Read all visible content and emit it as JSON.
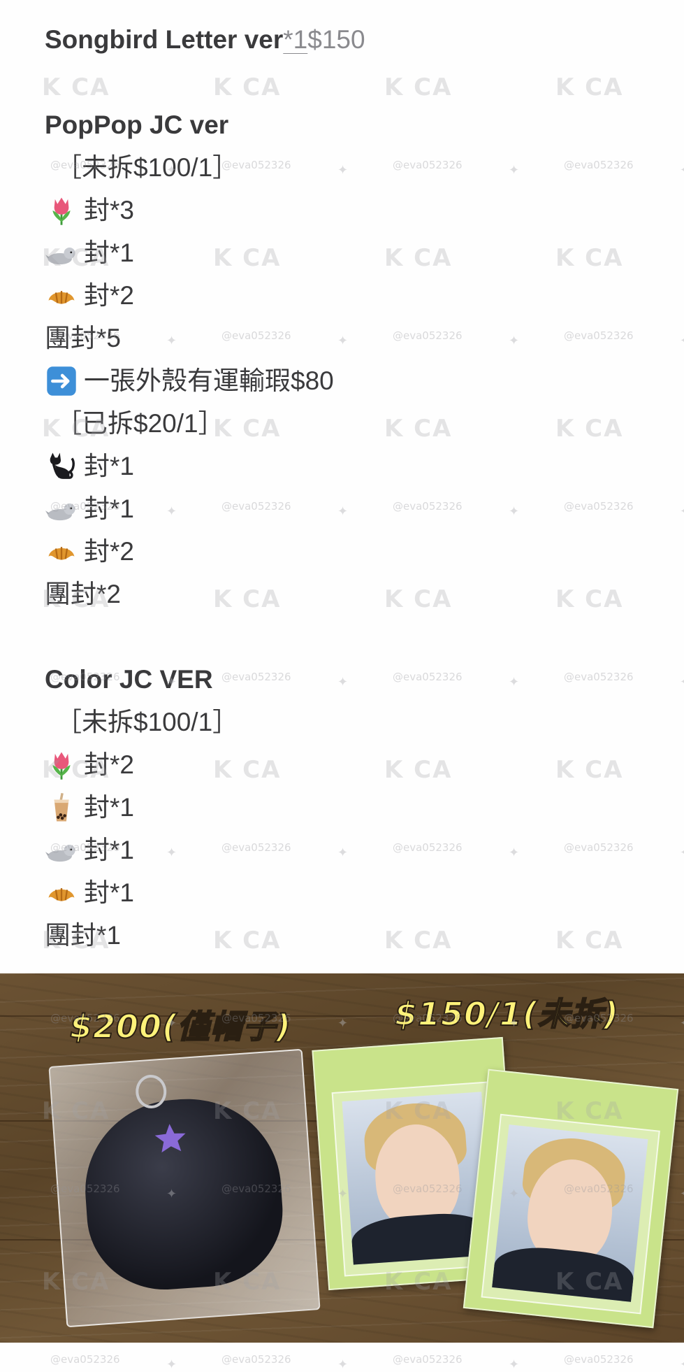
{
  "notes": {
    "songbird": {
      "label": "Songbird Letter ver ",
      "qty": "*1",
      "price": " $150"
    },
    "poppop": {
      "title": "PopPop JC ver",
      "unopened": "［未拆$100/1］",
      "items1": [
        {
          "icon": "tulip-icon",
          "text": "封*3"
        },
        {
          "icon": "seal-icon",
          "text": "封*1"
        },
        {
          "icon": "croissant-icon",
          "text": "封*2"
        }
      ],
      "group1": "團封*5",
      "arrow_note": "一張外殼有運輸瑕$80",
      "opened": "［已拆$20/1］",
      "items2": [
        {
          "icon": "black-cat-icon",
          "text": "封*1"
        },
        {
          "icon": "seal-icon",
          "text": "封*1"
        },
        {
          "icon": "croissant-icon",
          "text": "封*2"
        }
      ],
      "group2": "團封*2"
    },
    "color": {
      "title": "Color JC VER",
      "unopened": "［未拆$100/1］",
      "items": [
        {
          "icon": "tulip-icon",
          "text": "封*2"
        },
        {
          "icon": "bubble-tea-icon",
          "text": "封*1"
        },
        {
          "icon": "seal-icon",
          "text": "封*1"
        },
        {
          "icon": "croissant-icon",
          "text": "封*1"
        }
      ],
      "group": "團封*1"
    }
  },
  "photo": {
    "price_hat": "$200(僅帽子)",
    "price_card": "$150/1(未拆)"
  },
  "watermark": {
    "logo": "K CA",
    "handle": "@eva052326"
  },
  "colors": {
    "text": "#3a3a3c",
    "price_fill": "#fff27a",
    "sleeve": "#c9e38a"
  }
}
